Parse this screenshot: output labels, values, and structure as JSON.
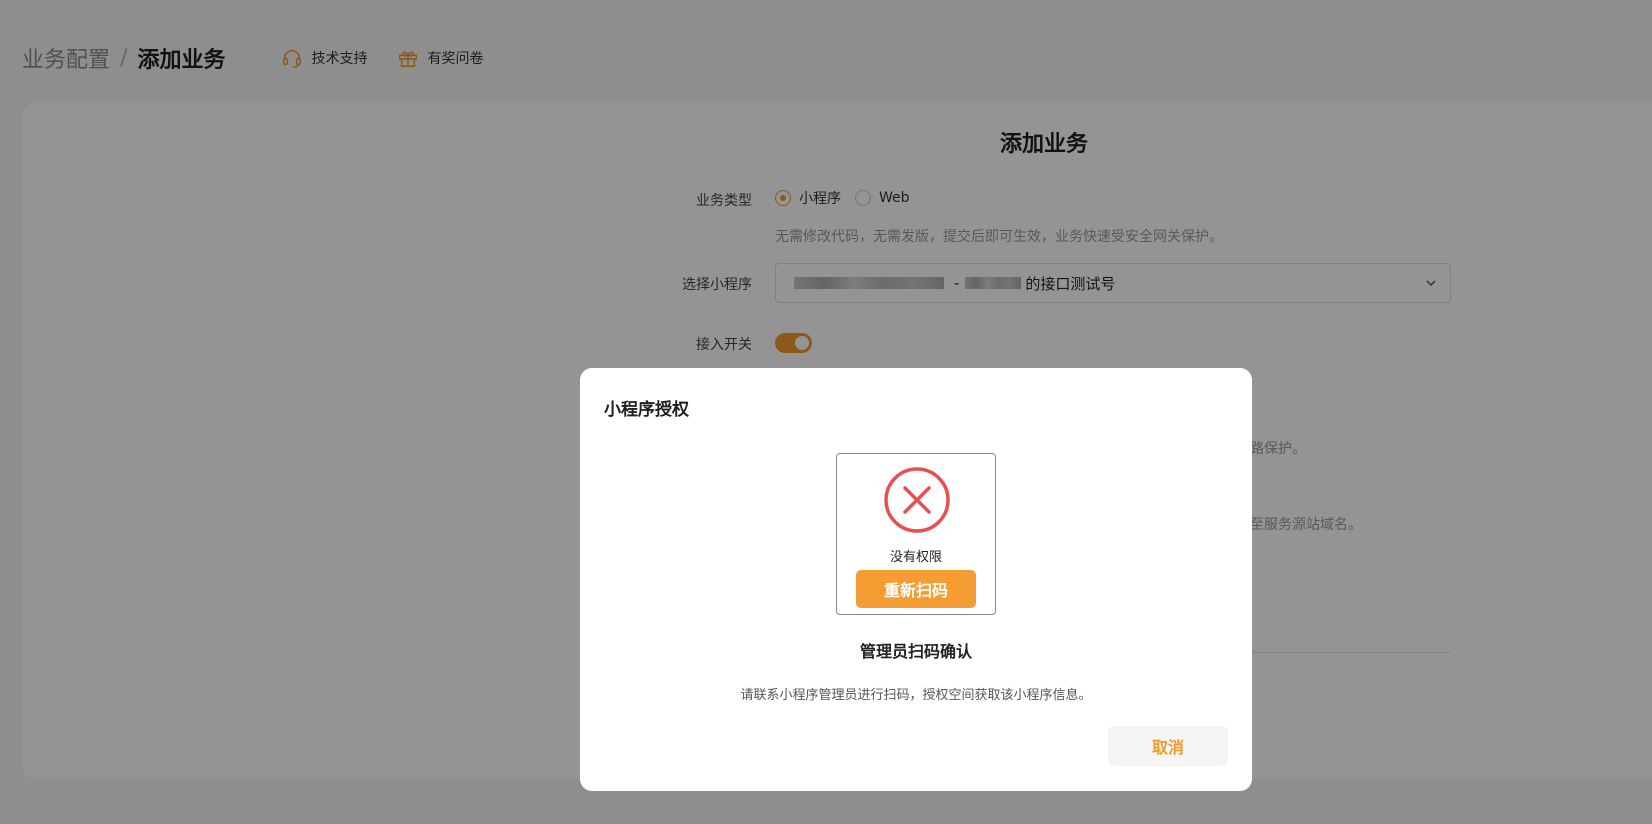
{
  "breadcrumb": {
    "parent": "业务配置",
    "separator": "/",
    "current": "添加业务"
  },
  "header_links": {
    "support": "技术支持",
    "survey": "有奖问卷"
  },
  "form": {
    "title": "添加业务",
    "business_type_label": "业务类型",
    "business_type_options": [
      "小程序",
      "Web"
    ],
    "business_type_selected": "小程序",
    "business_type_hint": "无需修改代码，无需发版，提交后即可生效，业务快速受安全网关保护。",
    "select_miniprogram_label": "选择小程序",
    "select_miniprogram_value_suffix": "的接口测试号",
    "select_miniprogram_separator": "-",
    "access_switch_label": "接入开关",
    "access_switch_on": true,
    "partial_hint_1": "路保护。",
    "partial_hint_2": "至服务源站域名。"
  },
  "modal": {
    "title": "小程序授权",
    "status_text": "没有权限",
    "rescan_label": "重新扫码",
    "subtitle": "管理员扫码确认",
    "description": "请联系小程序管理员进行扫码，授权空间获取该小程序信息。",
    "cancel_label": "取消"
  },
  "colors": {
    "accent": "#f39a2a",
    "error": "#e8504f"
  },
  "icons": {
    "support": "headset-icon",
    "survey": "gift-icon",
    "error": "error-circle-icon",
    "dropdown": "chevron-down-icon"
  }
}
